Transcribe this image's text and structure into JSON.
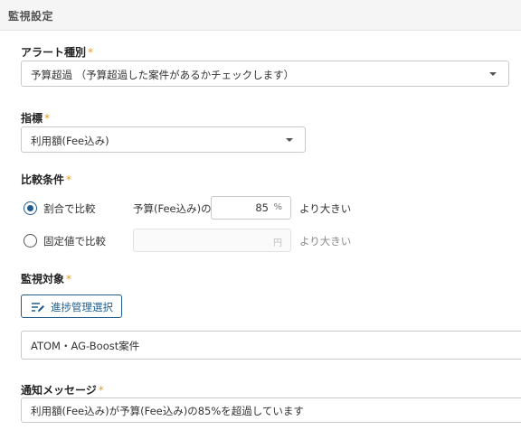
{
  "section": {
    "title": "監視設定"
  },
  "alert_type": {
    "label": "アラート種別",
    "required_mark": "*",
    "selected": "予算超過 （予算超過した案件があるかチェックします）"
  },
  "indicator": {
    "label": "指標",
    "required_mark": "*",
    "selected": "利用額(Fee込み)"
  },
  "comparison": {
    "label": "比較条件",
    "required_mark": "*",
    "options": [
      {
        "label": "割合で比較",
        "checked": true,
        "prefix": "予算(Fee込み)の",
        "value": "85",
        "unit": "%",
        "suffix": "より大きい"
      },
      {
        "label": "固定値で比較",
        "checked": false,
        "prefix": "",
        "value": "",
        "unit": "円",
        "suffix": "より大きい"
      }
    ]
  },
  "target": {
    "label": "監視対象",
    "required_mark": "*",
    "button_label": "進捗管理選択",
    "button_icon": "list-edit-icon",
    "value": "ATOM・AG-Boost案件"
  },
  "notification": {
    "label": "通知メッセージ",
    "required_mark": "*",
    "value": "利用額(Fee込み)が予算(Fee込み)の85%を超過しています"
  },
  "colors": {
    "accent": "#1f5c8e",
    "required": "#e69b1e",
    "border": "#c9c9c9",
    "header_bg": "#f5f5f5"
  }
}
